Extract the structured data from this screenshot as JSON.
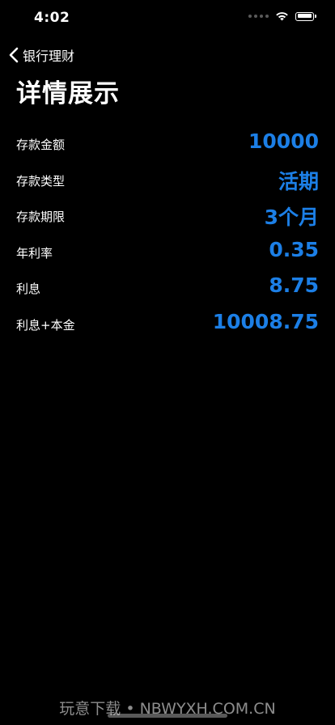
{
  "status_bar": {
    "time": "4:02"
  },
  "nav": {
    "back_label": "银行理财"
  },
  "page": {
    "title": "详情展示"
  },
  "details": [
    {
      "label": "存款金额",
      "value": "10000"
    },
    {
      "label": "存款类型",
      "value": "活期"
    },
    {
      "label": "存款期限",
      "value": "3个月"
    },
    {
      "label": "年利率",
      "value": "0.35"
    },
    {
      "label": "利息",
      "value": "8.75"
    },
    {
      "label": "利息+本金",
      "value": "10008.75"
    }
  ],
  "watermark": "玩意下载 • NBWYXH.COM.CN",
  "colors": {
    "background": "#000000",
    "value_accent": "#1c7fe6",
    "text": "#ffffff"
  }
}
